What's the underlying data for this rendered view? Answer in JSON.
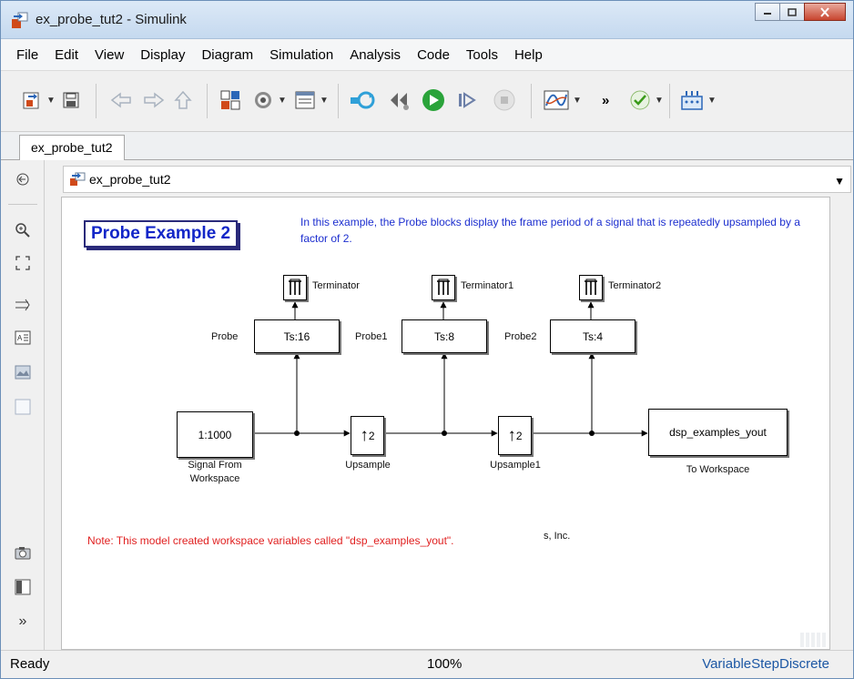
{
  "window": {
    "title": "ex_probe_tut2 - Simulink"
  },
  "menu": [
    "File",
    "Edit",
    "View",
    "Display",
    "Diagram",
    "Simulation",
    "Analysis",
    "Code",
    "Tools",
    "Help"
  ],
  "toolbar": {
    "more": "»"
  },
  "tab": {
    "label": "ex_probe_tut2"
  },
  "address": {
    "path": "ex_probe_tut2"
  },
  "palette": {
    "expand": "»"
  },
  "diagram": {
    "title": "Probe  Example 2",
    "description": "In this example, the Probe blocks display the frame period of a signal that is repeatedly upsampled by a factor of 2.",
    "blocks": {
      "source": {
        "text": "1:1000",
        "label": "Signal From\nWorkspace"
      },
      "up1": {
        "text": "↑",
        "sub": "2",
        "label": "Upsample"
      },
      "up2": {
        "text": "↑",
        "sub": "2",
        "label": "Upsample1"
      },
      "sink": {
        "text": "dsp_examples_yout",
        "label": "To Workspace"
      },
      "probe": {
        "text": "Ts:16",
        "label": "Probe"
      },
      "probe1": {
        "text": "Ts:8",
        "label": "Probe1"
      },
      "probe2": {
        "text": "Ts:4",
        "label": "Probe2"
      },
      "term": {
        "label": "Terminator"
      },
      "term1": {
        "label": "Terminator1"
      },
      "term2": {
        "label": "Terminator2"
      }
    },
    "note": "Note: This model created workspace variables called \"dsp_examples_yout\".",
    "note_tail": "s, Inc."
  },
  "status": {
    "state": "Ready",
    "zoom": "100%",
    "solver": "VariableStepDiscrete"
  },
  "colors": {
    "accent": "#1c57a4",
    "note": "#e02020",
    "description": "#1c2ecf"
  }
}
